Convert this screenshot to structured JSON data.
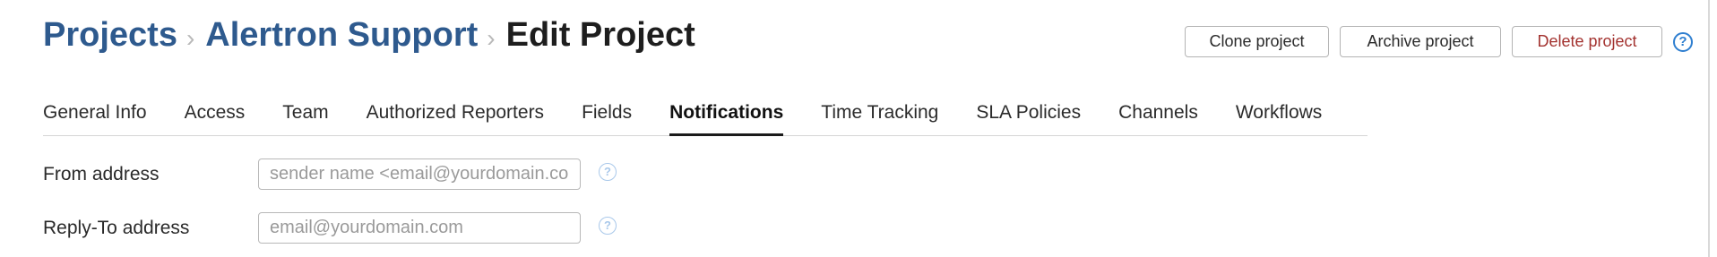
{
  "breadcrumb": {
    "items": [
      "Projects",
      "Alertron Support"
    ],
    "separator": "›",
    "current": "Edit Project"
  },
  "actions": {
    "clone_label": "Clone project",
    "archive_label": "Archive project",
    "delete_label": "Delete project",
    "help_glyph": "?"
  },
  "tabs": [
    {
      "label": "General Info",
      "active": false
    },
    {
      "label": "Access",
      "active": false
    },
    {
      "label": "Team",
      "active": false
    },
    {
      "label": "Authorized Reporters",
      "active": false
    },
    {
      "label": "Fields",
      "active": false
    },
    {
      "label": "Notifications",
      "active": true
    },
    {
      "label": "Time Tracking",
      "active": false
    },
    {
      "label": "SLA Policies",
      "active": false
    },
    {
      "label": "Channels",
      "active": false
    },
    {
      "label": "Workflows",
      "active": false
    }
  ],
  "form": {
    "from_address": {
      "label": "From address",
      "value": "",
      "placeholder": "sender name <email@yourdomain.com>"
    },
    "reply_to_address": {
      "label": "Reply-To address",
      "value": "",
      "placeholder": "email@yourdomain.com"
    },
    "help_glyph": "?"
  },
  "colors": {
    "link": "#2e5a8e",
    "delete": "#a3322f",
    "help_primary": "#2f7fd0",
    "help_muted": "#a9c8ea"
  },
  "icons": {
    "help": "question-circle-icon",
    "separator": "chevron-right-icon"
  }
}
